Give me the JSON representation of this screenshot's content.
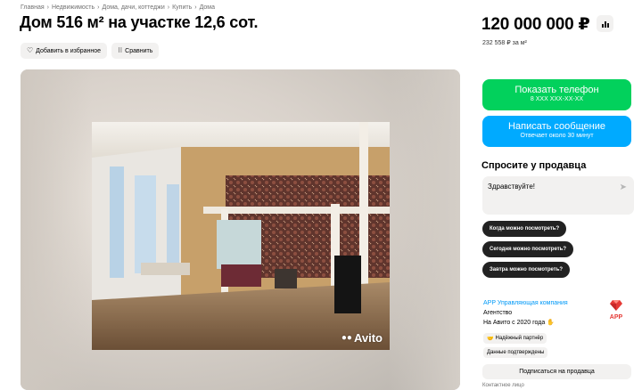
{
  "breadcrumbs": [
    "Главная",
    "Недвижимость",
    "Дома, дачи, коттеджи",
    "Купить",
    "Дома"
  ],
  "breadcrumb_separator": "›",
  "listing": {
    "title": "Дом 516 м² на участке 12,6 сот.",
    "price": "120 000 000 ₽",
    "price_per_m2": "232 558 ₽ за м²"
  },
  "actions": {
    "favorite_label": "Добавить в избранное",
    "compare_label": "Сравнить"
  },
  "gallery": {
    "watermark": "Avito"
  },
  "contact_buttons": {
    "phone_label": "Показать телефон",
    "phone_sub": "8 XXX XXX-XX-XX",
    "message_label": "Написать сообщение",
    "message_sub": "Отвечает около 30 минут"
  },
  "ask_seller": {
    "title": "Спросите у продавца",
    "message_value": "Здравствуйте!",
    "quick_questions": [
      "Когда можно посмотреть?",
      "Сегодня можно посмотреть?",
      "Завтра можно посмотреть?"
    ]
  },
  "seller": {
    "name": "APP Управляющая компания",
    "type": "Агентство",
    "since": "На Авито с 2020 года",
    "logo_text": "APP",
    "badges": [
      "Надёжный партнёр",
      "Данные подтверждены"
    ],
    "subscribe_label": "Подписаться на продавца",
    "contact_person_label": "Контактное лицо"
  },
  "colors": {
    "phone_button": "#02d15c",
    "message_button": "#00aaff",
    "seller_link": "#0099f7",
    "chip_bg": "#222222",
    "logo_red": "#e53935"
  },
  "icons": {
    "favorite": "heart-icon",
    "compare": "compare-icon",
    "price_history": "bar-chart-icon",
    "send": "send-arrow-icon",
    "badge_partner": "handshake-icon"
  }
}
